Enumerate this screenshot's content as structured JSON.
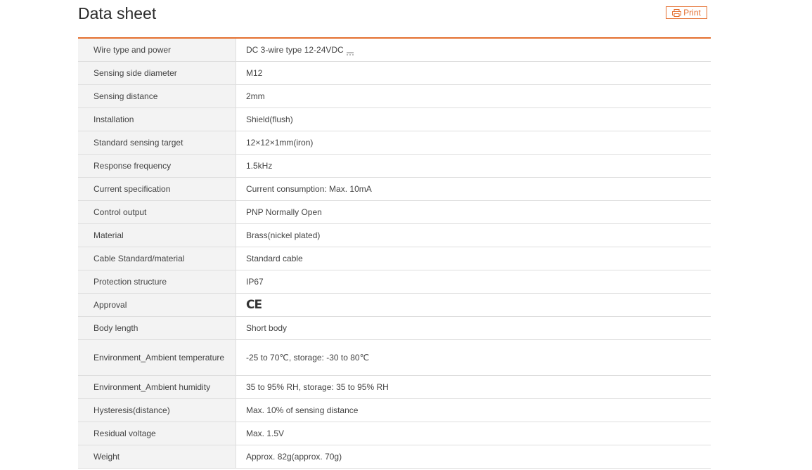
{
  "header": {
    "title": "Data sheet",
    "print_label": "Print"
  },
  "accent_color": "#e46f2f",
  "rows": [
    {
      "label": "Wire type and power",
      "value": "DC 3-wire type 12-24VDC",
      "icon": "dc-symbol-icon"
    },
    {
      "label": "Sensing side diameter",
      "value": "M12"
    },
    {
      "label": "Sensing distance",
      "value": "2mm"
    },
    {
      "label": "Installation",
      "value": "Shield(flush)"
    },
    {
      "label": "Standard sensing target",
      "value": "12×12×1mm(iron)"
    },
    {
      "label": "Response frequency",
      "value": "1.5kHz"
    },
    {
      "label": "Current specification",
      "value": "Current consumption: Max. 10mA"
    },
    {
      "label": "Control output",
      "value": "PNP Normally Open"
    },
    {
      "label": "Material",
      "value": "Brass(nickel plated)"
    },
    {
      "label": "Cable Standard/material",
      "value": "Standard cable"
    },
    {
      "label": "Protection structure",
      "value": "IP67"
    },
    {
      "label": "Approval",
      "value": "CE",
      "icon": "ce-mark-icon"
    },
    {
      "label": "Body length",
      "value": "Short body"
    },
    {
      "label": "Environment_Ambient temperature",
      "value": "-25 to 70℃, storage: -30 to 80℃"
    },
    {
      "label": "Environment_Ambient humidity",
      "value": "35 to 95% RH, storage: 35 to 95% RH"
    },
    {
      "label": "Hysteresis(distance)",
      "value": "Max. 10% of sensing distance"
    },
    {
      "label": "Residual voltage",
      "value": "Max. 1.5V"
    },
    {
      "label": "Weight",
      "value": "Approx. 82g(approx. 70g)"
    }
  ]
}
